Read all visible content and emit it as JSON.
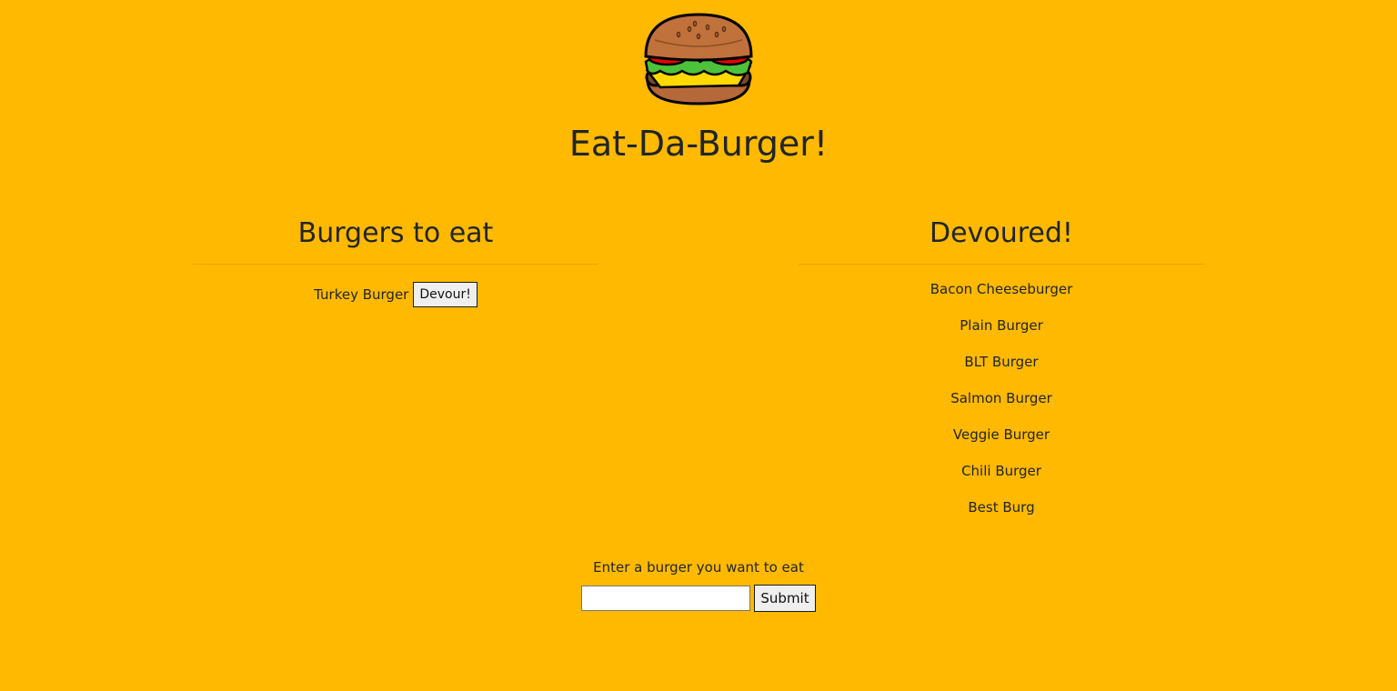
{
  "header": {
    "title": "Eat-Da-Burger!",
    "logo_icon": "burger-icon"
  },
  "to_eat": {
    "heading": "Burgers to eat",
    "items": [
      {
        "name": "Turkey Burger",
        "button_label": "Devour!"
      }
    ]
  },
  "devoured": {
    "heading": "Devoured!",
    "items": [
      "Bacon Cheeseburger",
      "Plain Burger",
      "BLT Burger",
      "Salmon Burger",
      "Veggie Burger",
      "Chili Burger",
      "Best Burg"
    ]
  },
  "form": {
    "label": "Enter a burger you want to eat",
    "input_value": "",
    "submit_label": "Submit"
  },
  "colors": {
    "background": "#ffb901",
    "text": "#212529"
  }
}
